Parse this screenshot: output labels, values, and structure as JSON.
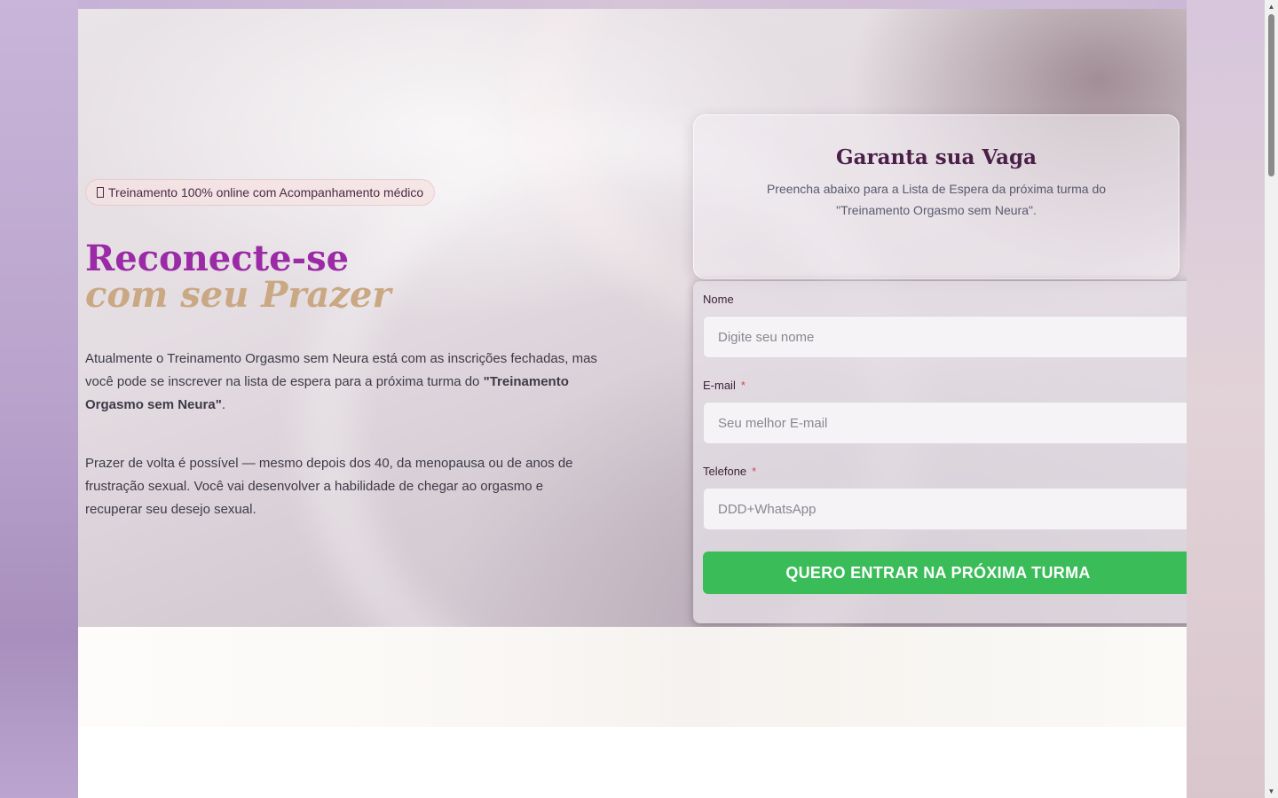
{
  "hero": {
    "badge_text": "Treinamento 100% online com Acompanhamento médico",
    "title_line1": "Reconecte-se",
    "title_line2": "com seu Prazer",
    "para1_part1": "Atualmente o Treinamento Orgasmo sem Neura está com as inscrições fechadas, mas você pode se inscrever na lista de espera para a próxima turma do ",
    "para1_bold": "\"Treinamento Orgasmo sem Neura\"",
    "para1_end": ".",
    "para2": "Prazer de volta é possível — mesmo depois dos 40, da menopausa ou de anos de frustração sexual. Você vai desenvolver a habilidade de chegar ao orgasmo e recuperar seu desejo sexual."
  },
  "form_card": {
    "title": "Garanta sua Vaga",
    "subtitle": "Preencha abaixo para a Lista de Espera da próxima turma do \"Treinamento Orgasmo sem Neura\".",
    "fields": [
      {
        "label": "Nome",
        "placeholder": "Digite seu nome",
        "required": false
      },
      {
        "label": "E-mail",
        "placeholder": "Seu melhor E-mail",
        "required": true
      },
      {
        "label": "Telefone",
        "placeholder": "DDD+WhatsApp",
        "required": true
      }
    ],
    "required_mark": "*",
    "submit_label": "QUERO ENTRAR NA PRÓXIMA TURMA"
  },
  "scrollbar": {
    "up_arrow": "▲",
    "down_arrow": "▼"
  },
  "colors": {
    "title_purple": "#9b2aa6",
    "title_gold": "#c9a883",
    "submit_green": "#3abc59",
    "required_red": "#d24c4c"
  }
}
